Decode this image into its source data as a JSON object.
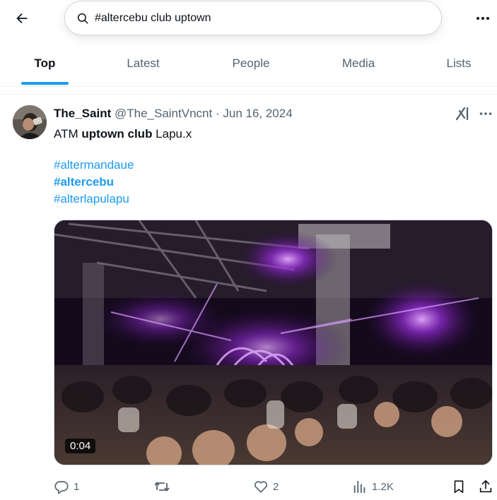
{
  "search": {
    "query": "#altercebu club uptown"
  },
  "tabs": [
    {
      "label": "Top"
    },
    {
      "label": "Latest"
    },
    {
      "label": "People"
    },
    {
      "label": "Media"
    },
    {
      "label": "Lists"
    }
  ],
  "active_tab": "Top",
  "tweet": {
    "display_name": "The_Saint",
    "handle": "@The_SaintVncnt",
    "separator": "·",
    "date": "Jun 16, 2024",
    "text_pre": "ATM ",
    "text_bold": "uptown club",
    "text_post": " Lapu.x",
    "hashtags": [
      "#altermandaue",
      "#altercebu",
      "#alterlapulapu"
    ],
    "video_duration": "0:04",
    "stats": {
      "replies": "1",
      "reposts": "",
      "likes": "2",
      "views": "1.2K"
    }
  },
  "icons": {
    "back": "arrow-left-icon",
    "search": "search-icon",
    "more": "more-horizontal-icon",
    "grok": "grok-icon",
    "reply": "reply-icon",
    "repost": "repost-icon",
    "like": "heart-icon",
    "views": "views-icon",
    "bookmark": "bookmark-icon",
    "share": "share-icon"
  },
  "colors": {
    "accent": "#1d9bf0",
    "text": "#0f1419",
    "muted": "#536471",
    "border": "#eff3f4"
  }
}
